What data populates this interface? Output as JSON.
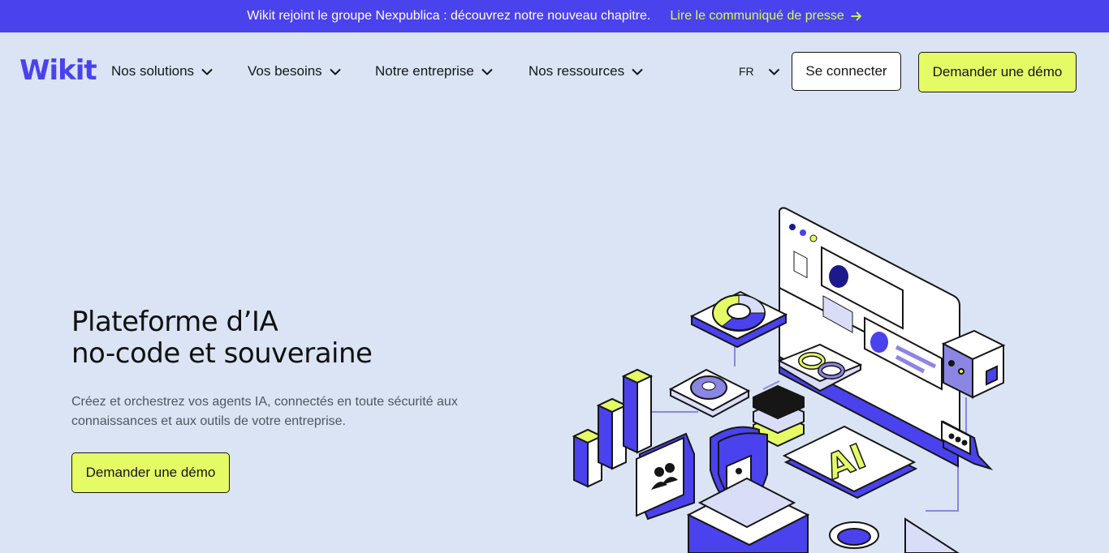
{
  "banner": {
    "text": "Wikit rejoint le groupe Nexpublica : découvrez notre nouveau chapitre.",
    "link_label": "Lire le communiqué de presse",
    "link_icon": "arrow-right-icon"
  },
  "header": {
    "logo": "Wikit",
    "nav": [
      {
        "label": "Nos solutions",
        "icon": "chevron-down-icon"
      },
      {
        "label": "Vos besoins",
        "icon": "chevron-down-icon"
      },
      {
        "label": "Notre entreprise",
        "icon": "chevron-down-icon"
      },
      {
        "label": "Nos ressources",
        "icon": "chevron-down-icon"
      }
    ],
    "language": "FR",
    "login_label": "Se connecter",
    "demo_label": "Demander une démo"
  },
  "hero": {
    "title_line1": "Plateforme d’IA",
    "title_line2": "no-code et souveraine",
    "subtitle": "Créez et orchestrez vos agents IA, connectés en toute sécurité aux connaissances et aux outils de votre entreprise.",
    "cta_label": "Demander une démo",
    "illustration_badge": "AI"
  },
  "colors": {
    "brand": "#4a42ec",
    "accent": "#e4fb66",
    "background": "#dae4f4",
    "text": "#161616"
  }
}
